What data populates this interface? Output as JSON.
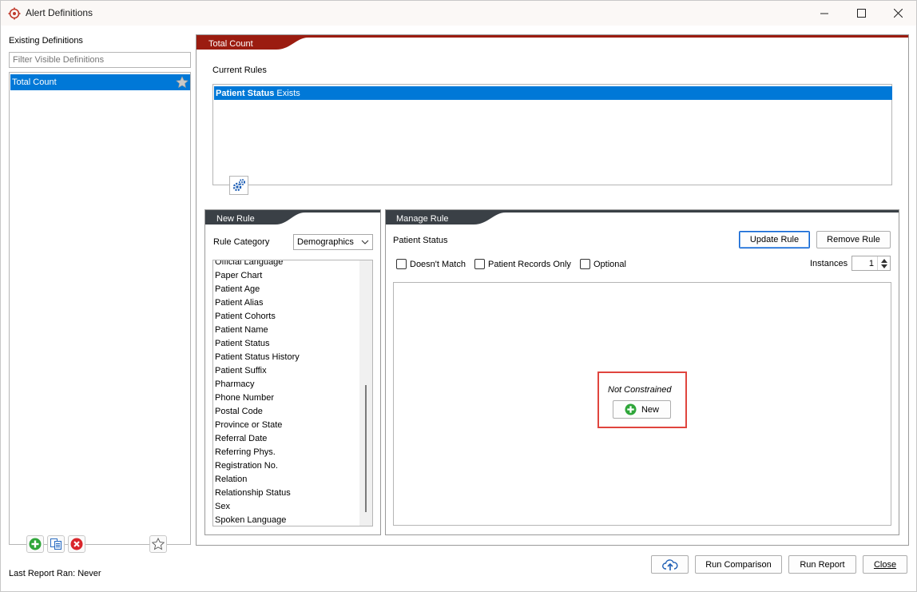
{
  "window": {
    "title": "Alert Definitions",
    "controls": [
      "minimize-icon",
      "maximize-icon",
      "close-icon"
    ]
  },
  "left": {
    "header": "Existing Definitions",
    "filter_placeholder": "Filter Visible Definitions",
    "definitions": [
      {
        "label": "Total Count",
        "selected": true,
        "favorite_icon": "star-icon"
      }
    ],
    "toolbar": [
      "add-icon",
      "copy-icon",
      "delete-icon",
      "star-outline-icon"
    ],
    "last_report": "Last Report Ran: Never"
  },
  "main": {
    "tab": "Total Count",
    "current_rules_label": "Current Rules",
    "rules": [
      {
        "bold": "Patient Status",
        "rest": " Exists",
        "selected": true
      }
    ],
    "gear_icon": "gears-icon"
  },
  "new_rule": {
    "tab": "New Rule",
    "category_label": "Rule Category",
    "category_value": "Demographics",
    "items": [
      "Official Language",
      "Paper Chart",
      "Patient Age",
      "Patient Alias",
      "Patient Cohorts",
      "Patient Name",
      "Patient Status",
      "Patient Status History",
      "Patient Suffix",
      "Pharmacy",
      "Phone Number",
      "Postal Code",
      "Province or State",
      "Referral Date",
      "Referring Phys.",
      "Registration No.",
      "Relation",
      "Relationship Status",
      "Sex",
      "Spoken Language"
    ]
  },
  "manage_rule": {
    "tab": "Manage Rule",
    "rule_name": "Patient Status",
    "update_label": "Update Rule",
    "remove_label": "Remove Rule",
    "checkboxes": [
      {
        "label": "Doesn't Match",
        "checked": false
      },
      {
        "label": "Patient Records Only",
        "checked": false
      },
      {
        "label": "Optional",
        "checked": false
      }
    ],
    "instances_label": "Instances",
    "instances_value": "1",
    "not_constrained": "Not Constrained",
    "new_label": "New"
  },
  "footer": {
    "upload_icon": "cloud-upload-icon",
    "run_comparison": "Run Comparison",
    "run_report": "Run Report",
    "close": "Close"
  },
  "colors": {
    "accent_red": "#9b1c10",
    "panel_dark": "#3a4046",
    "selection_blue": "#0078d7",
    "highlight_red": "#e0453e"
  }
}
